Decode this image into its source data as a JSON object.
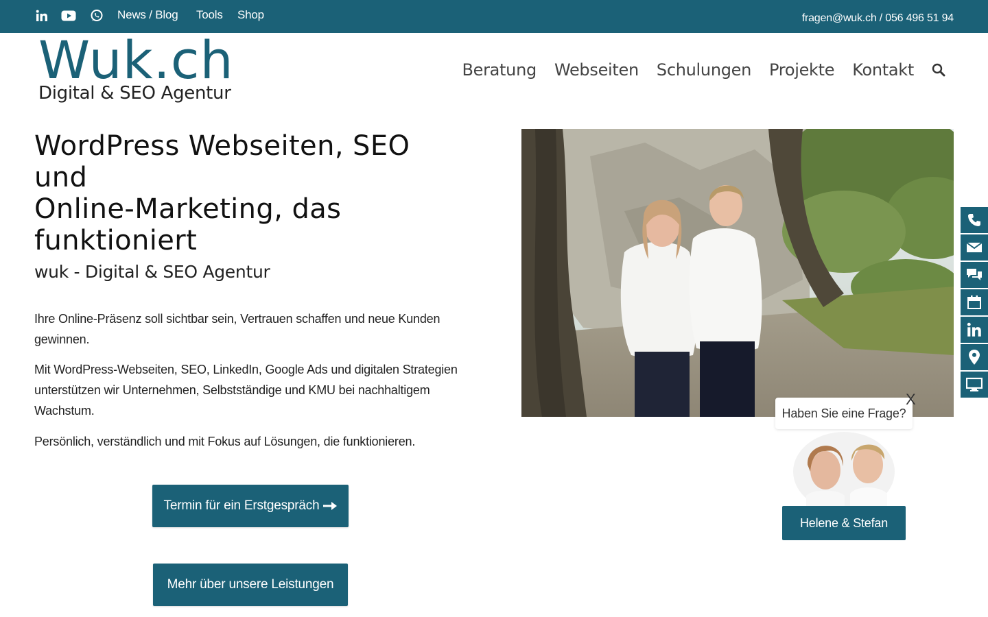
{
  "topbar": {
    "social_icons": [
      "linkedin-icon",
      "youtube-icon",
      "whatsapp-icon"
    ],
    "links": [
      "News / Blog",
      "Tools",
      "Shop"
    ],
    "contact": "fragen@wuk.ch / 056 496 51 94"
  },
  "logo": {
    "mark": "Wuk.ch",
    "tagline": "Digital & SEO Agentur"
  },
  "nav": {
    "items": [
      "Beratung",
      "Webseiten",
      "Schulungen",
      "Projekte",
      "Kontakt"
    ],
    "search_icon": "search-icon"
  },
  "hero": {
    "title_lines": [
      "WordPress Webseiten, SEO",
      "und",
      "Online-Marketing, das",
      "funktioniert"
    ],
    "subtitle": "wuk - Digital & SEO Agentur",
    "paragraphs": [
      "Ihre Online-Präsenz soll sichtbar sein, Vertrauen schaffen und neue Kunden gewinnen.",
      "Mit WordPress-Webseiten, SEO, LinkedIn, Google Ads und digitalen Strate­gien unterstützen wir Unternehmen, Selbstständige und KMU bei nachhalti­gem Wachstum.",
      "Persönlich, verständlich und mit Fokus auf Lösungen, die funktionieren."
    ],
    "cta_primary": "Termin für ein Erstgespräch",
    "cta_secondary": "Mehr über unsere Leistungen"
  },
  "sticky_bar": {
    "icons": [
      "phone-icon",
      "mail-icon",
      "chat-icon",
      "calendar-icon",
      "linkedin-icon",
      "location-icon",
      "monitor-icon"
    ]
  },
  "chat": {
    "question": "Haben Sie eine Frage?",
    "close": "X",
    "button": "Helene & Stefan"
  },
  "colors": {
    "brand": "#1b6177",
    "text": "#222222",
    "background": "#ffffff"
  }
}
